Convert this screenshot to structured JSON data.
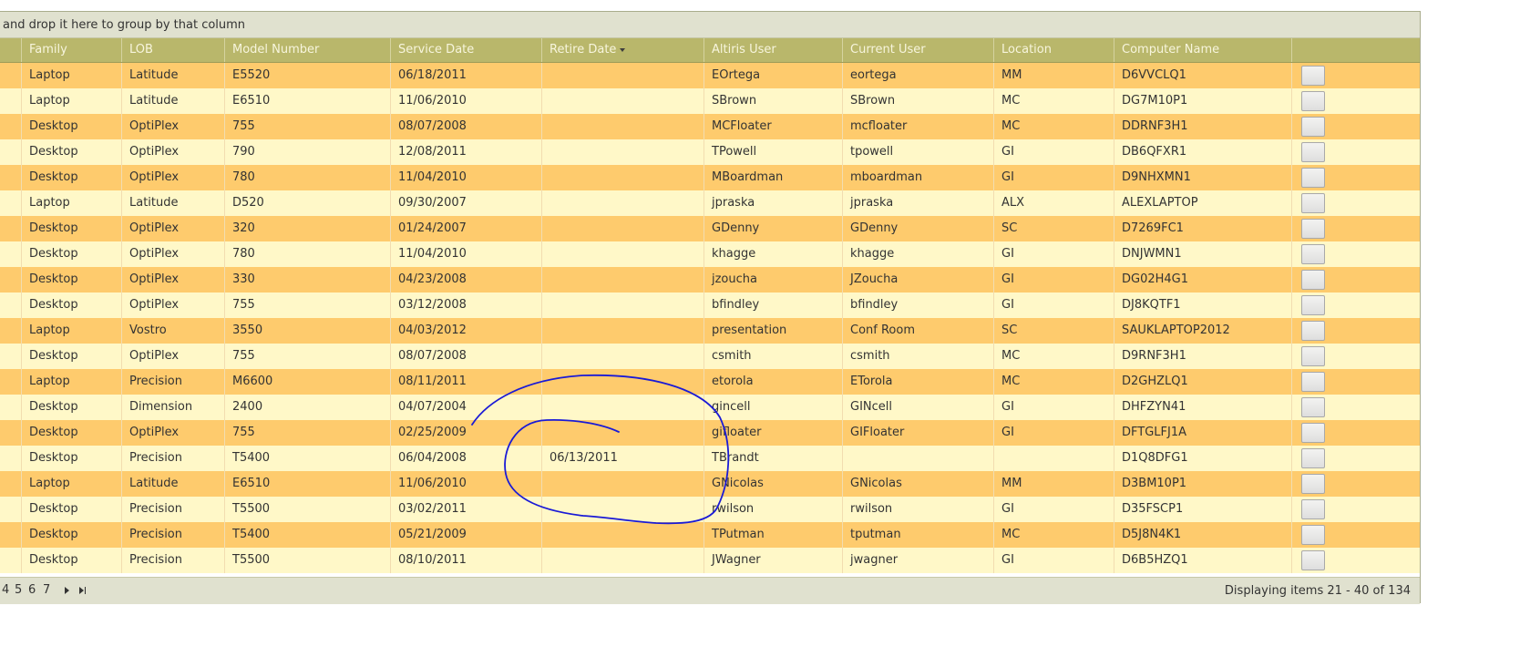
{
  "group_panel": {
    "text": "and drop it here to group by that column"
  },
  "columns": [
    "Family",
    "LOB",
    "Model Number",
    "Service Date",
    "Retire Date",
    "Altiris User",
    "Current User",
    "Location",
    "Computer Name",
    ""
  ],
  "sorted_column": "Retire Date",
  "rows": [
    [
      "Laptop",
      "Latitude",
      "E5520",
      "06/18/2011",
      "",
      "EOrtega",
      "eortega",
      "MM",
      "D6VVCLQ1"
    ],
    [
      "Laptop",
      "Latitude",
      "E6510",
      "11/06/2010",
      "",
      "SBrown",
      "SBrown",
      "MC",
      "DG7M10P1"
    ],
    [
      "Desktop",
      "OptiPlex",
      "755",
      "08/07/2008",
      "",
      "MCFloater",
      "mcfloater",
      "MC",
      "DDRNF3H1"
    ],
    [
      "Desktop",
      "OptiPlex",
      "790",
      "12/08/2011",
      "",
      "TPowell",
      "tpowell",
      "GI",
      "DB6QFXR1"
    ],
    [
      "Desktop",
      "OptiPlex",
      "780",
      "11/04/2010",
      "",
      "MBoardman",
      "mboardman",
      "GI",
      "D9NHXMN1"
    ],
    [
      "Laptop",
      "Latitude",
      "D520",
      "09/30/2007",
      "",
      "jpraska",
      "jpraska",
      "ALX",
      "ALEXLAPTOP"
    ],
    [
      "Desktop",
      "OptiPlex",
      "320",
      "01/24/2007",
      "",
      "GDenny",
      "GDenny",
      "SC",
      "D7269FC1"
    ],
    [
      "Desktop",
      "OptiPlex",
      "780",
      "11/04/2010",
      "",
      "khagge",
      "khagge",
      "GI",
      "DNJWMN1"
    ],
    [
      "Desktop",
      "OptiPlex",
      "330",
      "04/23/2008",
      "",
      "jzoucha",
      "JZoucha",
      "GI",
      "DG02H4G1"
    ],
    [
      "Desktop",
      "OptiPlex",
      "755",
      "03/12/2008",
      "",
      "bfindley",
      "bfindley",
      "GI",
      "DJ8KQTF1"
    ],
    [
      "Laptop",
      "Vostro",
      "3550",
      "04/03/2012",
      "",
      "presentation",
      "Conf Room",
      "SC",
      "SAUKLAPTOP2012"
    ],
    [
      "Desktop",
      "OptiPlex",
      "755",
      "08/07/2008",
      "",
      "csmith",
      "csmith",
      "MC",
      "D9RNF3H1"
    ],
    [
      "Laptop",
      "Precision",
      "M6600",
      "08/11/2011",
      "",
      "etorola",
      "ETorola",
      "MC",
      "D2GHZLQ1"
    ],
    [
      "Desktop",
      "Dimension",
      "2400",
      "04/07/2004",
      "",
      "gincell",
      "GINcell",
      "GI",
      "DHFZYN41"
    ],
    [
      "Desktop",
      "OptiPlex",
      "755",
      "02/25/2009",
      "",
      "gifloater",
      "GIFloater",
      "GI",
      "DFTGLFJ1A"
    ],
    [
      "Desktop",
      "Precision",
      "T5400",
      "06/04/2008",
      "06/13/2011",
      "TBrandt",
      "",
      "",
      "D1Q8DFG1"
    ],
    [
      "Laptop",
      "Latitude",
      "E6510",
      "11/06/2010",
      "",
      "GNicolas",
      "GNicolas",
      "MM",
      "D3BM10P1"
    ],
    [
      "Desktop",
      "Precision",
      "T5500",
      "03/02/2011",
      "",
      "rwilson",
      "rwilson",
      "GI",
      "D35FSCP1"
    ],
    [
      "Desktop",
      "Precision",
      "T5400",
      "05/21/2009",
      "",
      "TPutman",
      "tputman",
      "MC",
      "D5J8N4K1"
    ],
    [
      "Desktop",
      "Precision",
      "T5500",
      "08/10/2011",
      "",
      "JWagner",
      "jwagner",
      "GI",
      "D6B5HZQ1"
    ]
  ],
  "pager": {
    "pages": [
      "4",
      "5",
      "6",
      "7"
    ],
    "next_icon": "next-page-icon",
    "last_icon": "last-page-icon",
    "info": "Displaying items 21 - 40 of 134"
  },
  "annotation_color": "#1a1ad6",
  "colors": {
    "header_bg": "#b9b76b",
    "row_odd": "#fecb6d",
    "row_even": "#fff8c8",
    "toolbar_bg": "#e0e1cf"
  }
}
